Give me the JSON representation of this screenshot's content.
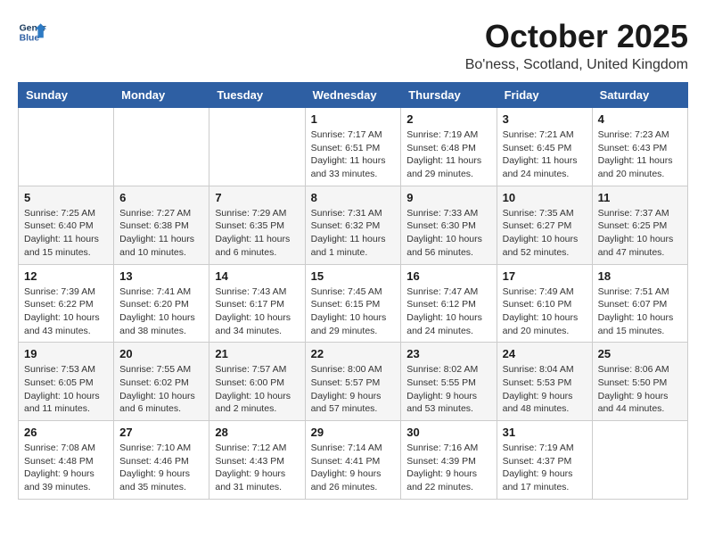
{
  "header": {
    "logo_line1": "General",
    "logo_line2": "Blue",
    "month_year": "October 2025",
    "location": "Bo'ness, Scotland, United Kingdom"
  },
  "weekdays": [
    "Sunday",
    "Monday",
    "Tuesday",
    "Wednesday",
    "Thursday",
    "Friday",
    "Saturday"
  ],
  "weeks": [
    [
      {
        "day": "",
        "info": ""
      },
      {
        "day": "",
        "info": ""
      },
      {
        "day": "",
        "info": ""
      },
      {
        "day": "1",
        "info": "Sunrise: 7:17 AM\nSunset: 6:51 PM\nDaylight: 11 hours and 33 minutes."
      },
      {
        "day": "2",
        "info": "Sunrise: 7:19 AM\nSunset: 6:48 PM\nDaylight: 11 hours and 29 minutes."
      },
      {
        "day": "3",
        "info": "Sunrise: 7:21 AM\nSunset: 6:45 PM\nDaylight: 11 hours and 24 minutes."
      },
      {
        "day": "4",
        "info": "Sunrise: 7:23 AM\nSunset: 6:43 PM\nDaylight: 11 hours and 20 minutes."
      }
    ],
    [
      {
        "day": "5",
        "info": "Sunrise: 7:25 AM\nSunset: 6:40 PM\nDaylight: 11 hours and 15 minutes."
      },
      {
        "day": "6",
        "info": "Sunrise: 7:27 AM\nSunset: 6:38 PM\nDaylight: 11 hours and 10 minutes."
      },
      {
        "day": "7",
        "info": "Sunrise: 7:29 AM\nSunset: 6:35 PM\nDaylight: 11 hours and 6 minutes."
      },
      {
        "day": "8",
        "info": "Sunrise: 7:31 AM\nSunset: 6:32 PM\nDaylight: 11 hours and 1 minute."
      },
      {
        "day": "9",
        "info": "Sunrise: 7:33 AM\nSunset: 6:30 PM\nDaylight: 10 hours and 56 minutes."
      },
      {
        "day": "10",
        "info": "Sunrise: 7:35 AM\nSunset: 6:27 PM\nDaylight: 10 hours and 52 minutes."
      },
      {
        "day": "11",
        "info": "Sunrise: 7:37 AM\nSunset: 6:25 PM\nDaylight: 10 hours and 47 minutes."
      }
    ],
    [
      {
        "day": "12",
        "info": "Sunrise: 7:39 AM\nSunset: 6:22 PM\nDaylight: 10 hours and 43 minutes."
      },
      {
        "day": "13",
        "info": "Sunrise: 7:41 AM\nSunset: 6:20 PM\nDaylight: 10 hours and 38 minutes."
      },
      {
        "day": "14",
        "info": "Sunrise: 7:43 AM\nSunset: 6:17 PM\nDaylight: 10 hours and 34 minutes."
      },
      {
        "day": "15",
        "info": "Sunrise: 7:45 AM\nSunset: 6:15 PM\nDaylight: 10 hours and 29 minutes."
      },
      {
        "day": "16",
        "info": "Sunrise: 7:47 AM\nSunset: 6:12 PM\nDaylight: 10 hours and 24 minutes."
      },
      {
        "day": "17",
        "info": "Sunrise: 7:49 AM\nSunset: 6:10 PM\nDaylight: 10 hours and 20 minutes."
      },
      {
        "day": "18",
        "info": "Sunrise: 7:51 AM\nSunset: 6:07 PM\nDaylight: 10 hours and 15 minutes."
      }
    ],
    [
      {
        "day": "19",
        "info": "Sunrise: 7:53 AM\nSunset: 6:05 PM\nDaylight: 10 hours and 11 minutes."
      },
      {
        "day": "20",
        "info": "Sunrise: 7:55 AM\nSunset: 6:02 PM\nDaylight: 10 hours and 6 minutes."
      },
      {
        "day": "21",
        "info": "Sunrise: 7:57 AM\nSunset: 6:00 PM\nDaylight: 10 hours and 2 minutes."
      },
      {
        "day": "22",
        "info": "Sunrise: 8:00 AM\nSunset: 5:57 PM\nDaylight: 9 hours and 57 minutes."
      },
      {
        "day": "23",
        "info": "Sunrise: 8:02 AM\nSunset: 5:55 PM\nDaylight: 9 hours and 53 minutes."
      },
      {
        "day": "24",
        "info": "Sunrise: 8:04 AM\nSunset: 5:53 PM\nDaylight: 9 hours and 48 minutes."
      },
      {
        "day": "25",
        "info": "Sunrise: 8:06 AM\nSunset: 5:50 PM\nDaylight: 9 hours and 44 minutes."
      }
    ],
    [
      {
        "day": "26",
        "info": "Sunrise: 7:08 AM\nSunset: 4:48 PM\nDaylight: 9 hours and 39 minutes."
      },
      {
        "day": "27",
        "info": "Sunrise: 7:10 AM\nSunset: 4:46 PM\nDaylight: 9 hours and 35 minutes."
      },
      {
        "day": "28",
        "info": "Sunrise: 7:12 AM\nSunset: 4:43 PM\nDaylight: 9 hours and 31 minutes."
      },
      {
        "day": "29",
        "info": "Sunrise: 7:14 AM\nSunset: 4:41 PM\nDaylight: 9 hours and 26 minutes."
      },
      {
        "day": "30",
        "info": "Sunrise: 7:16 AM\nSunset: 4:39 PM\nDaylight: 9 hours and 22 minutes."
      },
      {
        "day": "31",
        "info": "Sunrise: 7:19 AM\nSunset: 4:37 PM\nDaylight: 9 hours and 17 minutes."
      },
      {
        "day": "",
        "info": ""
      }
    ]
  ]
}
